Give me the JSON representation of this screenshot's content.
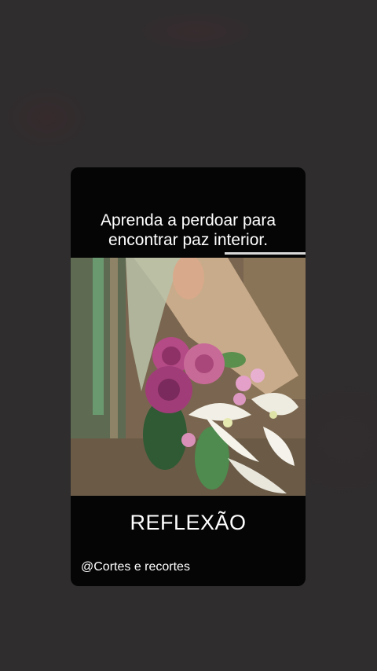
{
  "story": {
    "headline": "Aprenda a perdoar para\nencontrar paz interior.",
    "title": "REFLEXÃO",
    "handle": "@Cortes e recortes",
    "progress": 1.0,
    "image_icon": "flower-bouquet-photo"
  },
  "colors": {
    "background": "#2f2d2e",
    "card": "#050505",
    "text": "#ffffff",
    "progress": "#d8d8d8"
  }
}
